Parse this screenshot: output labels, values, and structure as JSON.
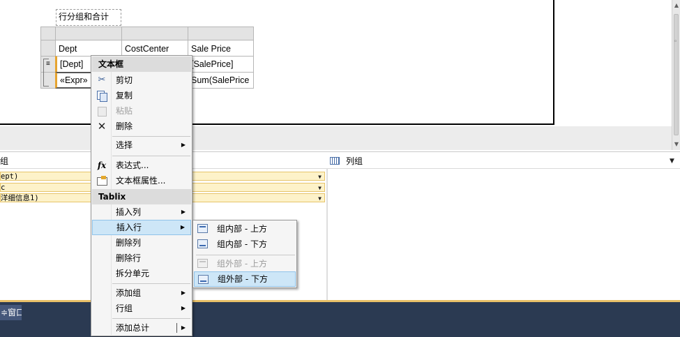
{
  "report": {
    "title": "行分组和合计",
    "tablix": {
      "header_row": [
        "Dept",
        "CostCenter",
        "Sale Price"
      ],
      "detail_row": [
        "[Dept]",
        "",
        "[SalePrice]"
      ],
      "total_row": [
        "«Expr»",
        "",
        "Sum(SalePrice"
      ]
    }
  },
  "grouping": {
    "row_groups_label": "组",
    "column_groups_label": "列组",
    "row_group_items": [
      "ept)",
      "c",
      "洋细信息1)"
    ]
  },
  "taskbar": {
    "button_label": "≑窗口"
  },
  "context_menu": {
    "textbox_section": "文本框",
    "cut": "剪切",
    "copy": "复制",
    "paste": "粘贴",
    "delete": "删除",
    "select": "选择",
    "expression": "表达式...",
    "textbox_properties": "文本框属性...",
    "tablix_section": "Tablix",
    "insert_column": "插入列",
    "insert_row": "插入行",
    "delete_column": "删除列",
    "delete_row": "删除行",
    "split_cells": "拆分单元",
    "add_group": "添加组",
    "row_group": "行组",
    "add_total": "添加总计"
  },
  "insert_row_submenu": {
    "inside_above": "组内部 - 上方",
    "inside_below": "组内部 - 下方",
    "outside_above": "组外部 - 上方",
    "outside_below": "组外部 - 下方"
  },
  "icons": {
    "cut": "scissors-icon",
    "copy": "copy-icon",
    "paste": "paste-icon",
    "delete": "delete-x-icon",
    "expression": "fx-icon",
    "properties": "properties-icon",
    "column_groups": "grid-icon"
  },
  "colors": {
    "menu_highlight": "#cde6f7",
    "group_item_bg": "#fdf2c9",
    "taskbar": "#2b3a52",
    "taskbar_accent": "#e8c068"
  }
}
